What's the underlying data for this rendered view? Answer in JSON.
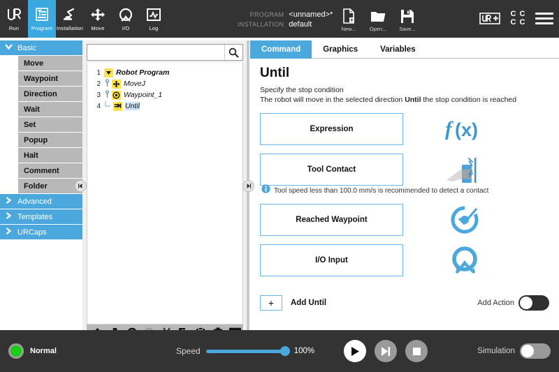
{
  "topbar": {
    "nav_tabs": [
      {
        "label": "Run",
        "icon": "ur-logo-icon",
        "active": false
      },
      {
        "label": "Program",
        "icon": "program-icon",
        "active": true
      },
      {
        "label": "Installation",
        "icon": "installation-icon",
        "active": false
      },
      {
        "label": "Move",
        "icon": "move-icon",
        "active": false
      },
      {
        "label": "I/O",
        "icon": "io-icon",
        "active": false
      },
      {
        "label": "Log",
        "icon": "log-icon",
        "active": false
      }
    ],
    "meta": {
      "program_key": "PROGRAM",
      "program_value": "<unnamed>*",
      "installation_key": "INSTALLATION",
      "installation_value": "default"
    },
    "file_actions": [
      {
        "label": "New...",
        "icon": "new-file-icon"
      },
      {
        "label": "Open...",
        "icon": "open-folder-icon"
      },
      {
        "label": "Save...",
        "icon": "save-disk-icon"
      }
    ],
    "urplus_icon": "ur-plus-icon",
    "cc_badges": [
      "C",
      "C",
      "C",
      "C"
    ],
    "hamburger_icon": "hamburger-menu-icon"
  },
  "sidebar": {
    "groups": [
      {
        "label": "Basic",
        "expanded": true,
        "chevron": "⌄",
        "items": [
          "Move",
          "Waypoint",
          "Direction",
          "Wait",
          "Set",
          "Popup",
          "Halt",
          "Comment",
          "Folder"
        ]
      },
      {
        "label": "Advanced",
        "expanded": false,
        "chevron": "›",
        "items": []
      },
      {
        "label": "Templates",
        "expanded": false,
        "chevron": "›",
        "items": []
      },
      {
        "label": "URCaps",
        "expanded": false,
        "chevron": "›",
        "items": []
      }
    ],
    "collapse_handle_icon": "collapse-left-icon"
  },
  "tree": {
    "search_placeholder": "",
    "search_value": "",
    "search_icon": "search-icon",
    "rows": [
      {
        "num": "1",
        "label": "Robot Program",
        "icon": "triangle-down-icon",
        "indent": 0,
        "bold": true,
        "selected": false
      },
      {
        "num": "2",
        "label": "MoveJ",
        "icon": "movej-icon",
        "indent": 1,
        "bold": false,
        "selected": false
      },
      {
        "num": "3",
        "label": "Waypoint_1",
        "icon": "waypoint-icon",
        "indent": 2,
        "bold": false,
        "selected": false
      },
      {
        "num": "4",
        "label": "Until",
        "icon": "until-icon",
        "indent": 3,
        "bold": false,
        "selected": true
      }
    ],
    "toolbar_icons": [
      "move-up-icon",
      "move-down-icon",
      "undo-icon",
      "redo-icon",
      "cut-icon",
      "copy-icon",
      "paste-icon",
      "delete-icon",
      "suppress-icon"
    ],
    "collapse_handle_icon": "collapse-right-icon"
  },
  "main": {
    "tabs": [
      {
        "label": "Command",
        "active": true
      },
      {
        "label": "Graphics",
        "active": false
      },
      {
        "label": "Variables",
        "active": false
      }
    ],
    "title": "Until",
    "desc_line1": "Specify the stop condition",
    "desc_line2_a": "The robot will move in the selected direction ",
    "desc_line2_b": "Until",
    "desc_line2_c": " the stop condition is reached",
    "options": [
      {
        "label": "Expression",
        "icon": "function-fx-icon"
      },
      {
        "label": "Tool Contact",
        "icon": "tool-contact-icon"
      },
      {
        "label": "Reached Waypoint",
        "icon": "reached-waypoint-icon"
      },
      {
        "label": "I/O Input",
        "icon": "io-input-icon"
      }
    ],
    "hint": {
      "icon": "info-icon",
      "text": "Tool speed less than 100.0 mm/s is recommended to detect a contact"
    },
    "add_until_label": "Add Until",
    "add_plus": "+",
    "add_action_label": "Add Action",
    "add_action_on": false
  },
  "bottombar": {
    "status_label": "Normal",
    "status_color": "#18cc18",
    "speed_label": "Speed",
    "speed_value": "100%",
    "speed_percent": 100,
    "transport": [
      {
        "name": "play-button",
        "icon": "play-icon"
      },
      {
        "name": "step-button",
        "icon": "step-icon"
      },
      {
        "name": "stop-button",
        "icon": "stop-icon"
      }
    ],
    "simulation_label": "Simulation",
    "simulation_on": false
  },
  "colors": {
    "accent_blue": "#4aa8dd",
    "dark_bar": "#333333",
    "button_border": "#6fb5e2",
    "tree_icon_yellow": "#ffe34d",
    "status_green": "#18cc18"
  }
}
